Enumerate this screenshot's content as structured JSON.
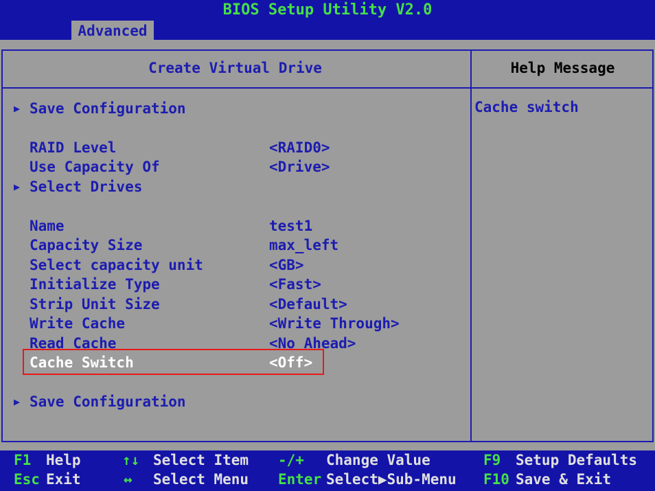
{
  "app": {
    "title": "BIOS Setup Utility V2.0",
    "active_tab": "Advanced"
  },
  "main": {
    "header": "Create Virtual Drive",
    "rows": [
      {
        "label": "Save Configuration",
        "value": "",
        "submenu": true
      },
      {
        "label": "RAID Level",
        "value": "<RAID0>",
        "submenu": false
      },
      {
        "label": "Use Capacity Of",
        "value": "<Drive>",
        "submenu": false
      },
      {
        "label": "Select Drives",
        "value": "",
        "submenu": true
      },
      {
        "label": "Name",
        "value": "test1",
        "submenu": false
      },
      {
        "label": "Capacity Size",
        "value": "max_left",
        "submenu": false
      },
      {
        "label": "Select capacity unit",
        "value": "<GB>",
        "submenu": false
      },
      {
        "label": "Initialize Type",
        "value": "<Fast>",
        "submenu": false
      },
      {
        "label": "Strip Unit Size",
        "value": "<Default>",
        "submenu": false
      },
      {
        "label": "Write Cache",
        "value": "<Write Through>",
        "submenu": false
      },
      {
        "label": "Read Cache",
        "value": "<No Ahead>",
        "submenu": false
      },
      {
        "label": "Cache Switch",
        "value": "<Off>",
        "submenu": false,
        "selected": true
      },
      {
        "label": "Save Configuration",
        "value": "",
        "submenu": true
      }
    ]
  },
  "help": {
    "header": "Help Message",
    "text": "Cache switch"
  },
  "footer": {
    "f1_key": "F1",
    "f1_desc": "Help",
    "updown_key": "↑↓",
    "updown_desc": "Select Item",
    "plusminus_key": "-/+",
    "plusminus_desc": "Change Value",
    "f9_key": "F9",
    "f9_desc": "Setup Defaults",
    "esc_key": "Esc",
    "esc_desc": "Exit",
    "leftright_key": "↔",
    "leftright_desc": "Select Menu",
    "enter_key": "Enter",
    "enter_desc": "Select▶Sub-Menu",
    "f10_key": "F10",
    "f10_desc": "Save & Exit"
  },
  "colors": {
    "background": "#9c9c9c",
    "bar": "#1313a8",
    "text_blue": "#1c1cb0",
    "key_green": "#46e046",
    "highlight_red": "#e81818"
  }
}
